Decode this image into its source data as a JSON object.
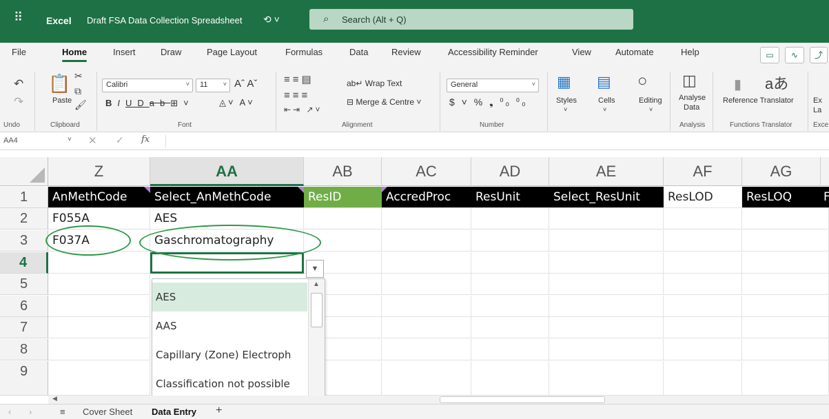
{
  "titlebar": {
    "app": "Excel",
    "doc_title": "Draft FSA Data Collection Spreadsheet",
    "search_placeholder": "Search (Alt + Q)"
  },
  "tabs": [
    "File",
    "Home",
    "Insert",
    "Draw",
    "Page Layout",
    "Formulas",
    "Data",
    "Review",
    "Accessibility Reminder",
    "View",
    "Automate",
    "Help"
  ],
  "active_tab": "Home",
  "ribbon": {
    "groups": {
      "undo": "Undo",
      "clipboard": "Clipboard",
      "font": "Font",
      "alignment": "Alignment",
      "number": "Number",
      "analysis": "Analysis",
      "functions_translator": "Functions Translator",
      "excel_labs": "Exce"
    },
    "paste": "Paste",
    "font_name": "Calibri",
    "font_size": "11",
    "wrap_text": "Wrap Text",
    "merge_centre": "Merge & Centre",
    "number_format": "General",
    "styles": "Styles",
    "cells": "Cells",
    "editing": "Editing",
    "analyse_data_1": "Analyse",
    "analyse_data_2": "Data",
    "reference_translator": "Reference Translator",
    "cut_tail_1": "Ex",
    "cut_tail_2": "La"
  },
  "formula_bar": {
    "name_box": "AA4",
    "fx": "fx"
  },
  "columns": [
    "Z",
    "AA",
    "AB",
    "AC",
    "AD",
    "AE",
    "AF",
    "AG"
  ],
  "selected_column": "AA",
  "rows": [
    "1",
    "2",
    "3",
    "4",
    "5",
    "6",
    "7",
    "8",
    "9"
  ],
  "selected_row": "4",
  "header_row": [
    "AnMethCode",
    "Select_AnMethCode",
    "ResID",
    "AccredProc",
    "ResUnit",
    "Select_ResUnit",
    "ResLOD",
    "ResLOQ",
    "F"
  ],
  "data_rows": [
    [
      "F055A",
      "AES"
    ],
    [
      "F037A",
      "Gaschromatography"
    ]
  ],
  "dropdown_options": [
    "AES",
    "AAS",
    "Capillary (Zone) Electroph",
    "Classification not possible"
  ],
  "sheets": {
    "cover": "Cover Sheet",
    "data_entry": "Data Entry",
    "add": "+"
  },
  "colors": {
    "excel_green": "#1e7145",
    "header_black": "#000000",
    "header_green": "#70ad47",
    "annotation_green": "#2f9a4a"
  }
}
